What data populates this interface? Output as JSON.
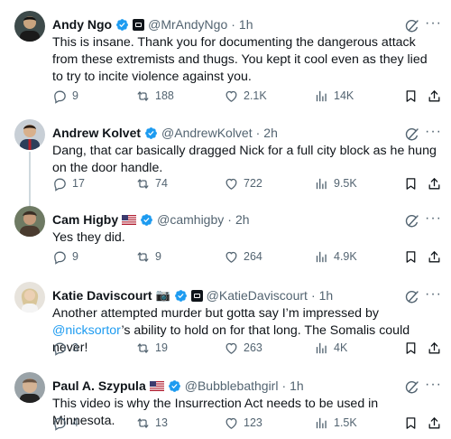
{
  "tweets": [
    {
      "name": "Andy Ngo",
      "handle": "@MrAndyNgo",
      "time": "1h",
      "text": "This is insane. Thank you for documenting the dangerous attack from these extremists and thugs. You kept it cool even as they lied to try to incite violence against you.",
      "replies": "9",
      "reposts": "188",
      "likes": "2.1K",
      "views": "14K"
    },
    {
      "name": "Andrew Kolvet",
      "handle": "@AndrewKolvet",
      "time": "2h",
      "text": "Dang, that car basically dragged Nick for a full city block as he hung on the door handle.",
      "replies": "17",
      "reposts": "74",
      "likes": "722",
      "views": "9.5K"
    },
    {
      "name": "Cam Higby",
      "handle": "@camhigby",
      "time": "2h",
      "text": "Yes they did.",
      "replies": "9",
      "reposts": "9",
      "likes": "264",
      "views": "4.9K"
    },
    {
      "name": "Katie Daviscourt",
      "handle": "@KatieDaviscourt",
      "time": "1h",
      "text_before": "Another attempted murder but gotta say I’m impressed by ",
      "mention": "@nicksortor",
      "text_after": "’s ability to hold on for that long. The Somalis could never!",
      "replies": "3",
      "reposts": "19",
      "likes": "263",
      "views": "4K"
    },
    {
      "name": "Paul A. Szypula",
      "handle": "@Bubblebathgirl",
      "time": "1h",
      "text": "This video is why the Insurrection Act needs to be used in Minnesota.",
      "replies": "4",
      "reposts": "13",
      "likes": "123",
      "views": "1.5K"
    }
  ],
  "icons": {
    "verified": "verified-badge-icon",
    "reply": "reply-icon",
    "repost": "repost-icon",
    "like": "heart-icon",
    "views": "views-chart-icon",
    "bookmark": "bookmark-icon",
    "share": "share-icon",
    "grok": "grok-icon",
    "more": "more-options-icon"
  },
  "colors": {
    "accent": "#1d9bf0",
    "text": "#0f1419",
    "muted": "#536471"
  }
}
